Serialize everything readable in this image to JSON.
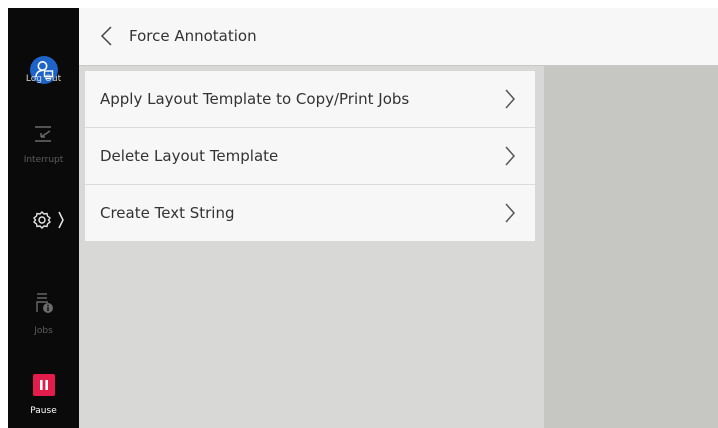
{
  "sidebar": {
    "logout": {
      "label": "Log Out",
      "icon": "user-logout-icon",
      "color": "#1d63c8"
    },
    "interrupt": {
      "label": "Interrupt",
      "icon": "interrupt-icon"
    },
    "settings": {
      "icon": "gear-icon"
    },
    "jobs": {
      "label": "Jobs",
      "icon": "jobs-icon"
    },
    "pause": {
      "label": "Pause",
      "icon": "pause-icon",
      "color": "#e21d4b"
    }
  },
  "header": {
    "title": "Force Annotation",
    "back_icon": "chevron-left-icon"
  },
  "menu": {
    "items": [
      {
        "label": "Apply Layout Template to Copy/Print Jobs",
        "icon": "chevron-right-icon"
      },
      {
        "label": "Delete Layout Template",
        "icon": "chevron-right-icon"
      },
      {
        "label": "Create Text String",
        "icon": "chevron-right-icon"
      }
    ]
  }
}
